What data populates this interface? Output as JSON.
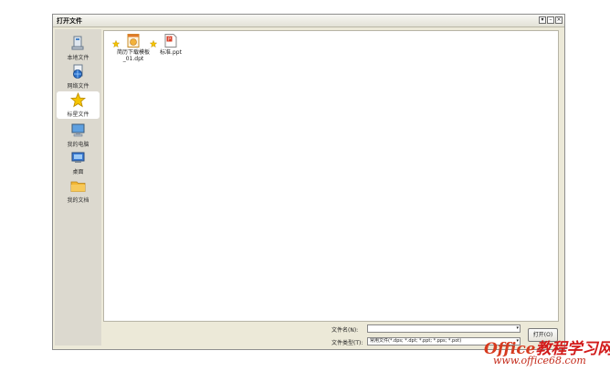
{
  "window": {
    "title": "打开文件",
    "controls": [
      "help",
      "minimize",
      "close"
    ]
  },
  "sidebar": {
    "items": [
      {
        "label": "本地文件",
        "icon": "computer-local-icon",
        "active": false
      },
      {
        "label": "网络文件",
        "icon": "network-globe-icon",
        "active": false
      },
      {
        "label": "标星文件",
        "icon": "star-icon",
        "active": true
      },
      {
        "label": "我的电脑",
        "icon": "monitor-icon",
        "active": false
      },
      {
        "label": "桌面",
        "icon": "desktop-icon",
        "active": false
      },
      {
        "label": "我的文档",
        "icon": "folder-icon",
        "active": false
      }
    ]
  },
  "files": [
    {
      "name": "简历下载模板_01.dpt",
      "icon": "dpt-template-icon",
      "starred": true
    },
    {
      "name": "标准.ppt",
      "icon": "ppt-file-icon",
      "starred": true
    }
  ],
  "form": {
    "filename_label": "文件名(N):",
    "filename_value": "",
    "filetype_label": "文件类型(T):",
    "filetype_value": "常用文件(*.dps; *.dpt; *.ppt; *.pps; *.pot)",
    "open_button": "打开(O)"
  },
  "watermark": {
    "brand_en": "Office",
    "brand_cn": "教程学习网",
    "url": "www.office68.com"
  },
  "colors": {
    "dialog_bg": "#ece9d8",
    "sidebar_bg": "#dcd9cf",
    "star": "#f5c400",
    "watermark": "#d21b1b"
  }
}
